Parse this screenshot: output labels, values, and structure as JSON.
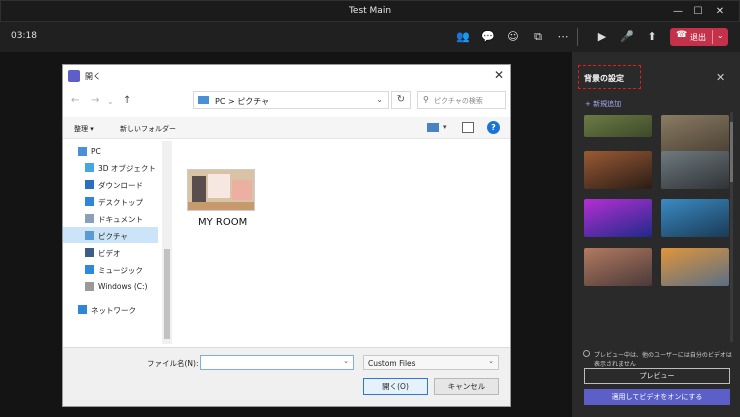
{
  "window": {
    "title": "Test Main"
  },
  "meeting": {
    "timer": "03:18",
    "leave_label": "退出"
  },
  "dialog": {
    "title": "開く",
    "address": {
      "pc": "PC",
      "folder": "ピクチャ"
    },
    "search_placeholder": "ピクチャの検索",
    "organize_label": "整理 ▾",
    "new_folder_label": "新しいフォルダー",
    "tree": [
      {
        "label": "PC",
        "icon": "pc-icon",
        "color": "#4a90d9"
      },
      {
        "label": "3D オブジェクト",
        "icon": "3d-objects-icon",
        "color": "#46a7e0"
      },
      {
        "label": "ダウンロード",
        "icon": "download-icon",
        "color": "#2b6fc2"
      },
      {
        "label": "デスクトップ",
        "icon": "desktop-icon",
        "color": "#2f86d8"
      },
      {
        "label": "ドキュメント",
        "icon": "documents-icon",
        "color": "#8aa0b8"
      },
      {
        "label": "ピクチャ",
        "icon": "pictures-icon",
        "color": "#5a9bd4"
      },
      {
        "label": "ビデオ",
        "icon": "videos-icon",
        "color": "#3b5d86"
      },
      {
        "label": "ミュージック",
        "icon": "music-icon",
        "color": "#2d8ad8"
      },
      {
        "label": "Windows (C:)",
        "icon": "drive-icon",
        "color": "#9a9a9a"
      },
      {
        "label": "ネットワーク",
        "icon": "network-icon",
        "color": "#2f86d8"
      }
    ],
    "folder": {
      "name": "MY ROOM"
    },
    "filename_label": "ファイル名(N):",
    "filename_value": "",
    "filetype_value": "Custom Files",
    "open_label": "開く(O)",
    "cancel_label": "キャンセル"
  },
  "panel": {
    "title": "背景の設定",
    "add_new": "+ 新規追加",
    "backgrounds": [
      {
        "name": "background-thumb-1",
        "colors": [
          "#6d7a45",
          "#3d4a2a"
        ]
      },
      {
        "name": "background-thumb-2",
        "colors": [
          "#8a7b63",
          "#4b4134"
        ]
      },
      {
        "name": "background-thumb-3",
        "colors": [
          "#9a5b34",
          "#2b1c16"
        ]
      },
      {
        "name": "background-thumb-4",
        "colors": [
          "#6f7a7f",
          "#2f3337"
        ]
      },
      {
        "name": "background-thumb-5",
        "colors": [
          "#b62fd4",
          "#1f2a8a"
        ]
      },
      {
        "name": "background-thumb-6",
        "colors": [
          "#3a8bc4",
          "#1b3a55"
        ]
      },
      {
        "name": "background-thumb-7",
        "colors": [
          "#b37a60",
          "#4a3a3a"
        ]
      },
      {
        "name": "background-thumb-8",
        "colors": [
          "#e0953a",
          "#5a6f86"
        ]
      }
    ],
    "preview_note": "プレビュー中は、他のユーザーには自分のビデオは表示されません",
    "preview_label": "プレビュー",
    "apply_label": "適用してビデオをオンにする"
  }
}
